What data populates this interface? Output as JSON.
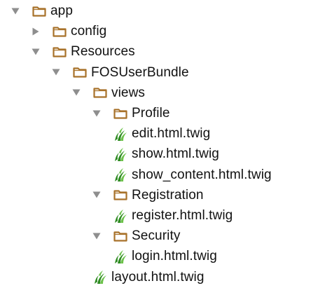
{
  "tree": {
    "items": [
      {
        "label": "app",
        "type": "folder",
        "state": "expanded",
        "level": 0
      },
      {
        "label": "config",
        "type": "folder",
        "state": "collapsed",
        "level": 1
      },
      {
        "label": "Resources",
        "type": "folder",
        "state": "expanded",
        "level": 1
      },
      {
        "label": "FOSUserBundle",
        "type": "folder",
        "state": "expanded",
        "level": 2
      },
      {
        "label": "views",
        "type": "folder",
        "state": "expanded",
        "level": 3
      },
      {
        "label": "Profile",
        "type": "folder",
        "state": "expanded",
        "level": 4
      },
      {
        "label": "edit.html.twig",
        "type": "twig-file",
        "level": 5
      },
      {
        "label": "show.html.twig",
        "type": "twig-file",
        "level": 5
      },
      {
        "label": "show_content.html.twig",
        "type": "twig-file",
        "level": 5
      },
      {
        "label": "Registration",
        "type": "folder",
        "state": "expanded",
        "level": 4
      },
      {
        "label": "register.html.twig",
        "type": "twig-file",
        "level": 5
      },
      {
        "label": "Security",
        "type": "folder",
        "state": "expanded",
        "level": 4
      },
      {
        "label": "login.html.twig",
        "type": "twig-file",
        "level": 5
      },
      {
        "label": "layout.html.twig",
        "type": "twig-file",
        "level": 4
      }
    ]
  },
  "colors": {
    "folder_stroke": "#a8722a",
    "folder_fill": "#ffffff",
    "arrow": "#8e8e8e",
    "twig_dark": "#2e8b22",
    "twig_light": "#6cc24a",
    "text": "#111111"
  },
  "icons": {
    "folder": "folder-icon",
    "twig-file": "twig-file-icon",
    "expanded": "disclosure-expanded-icon",
    "collapsed": "disclosure-collapsed-icon"
  }
}
